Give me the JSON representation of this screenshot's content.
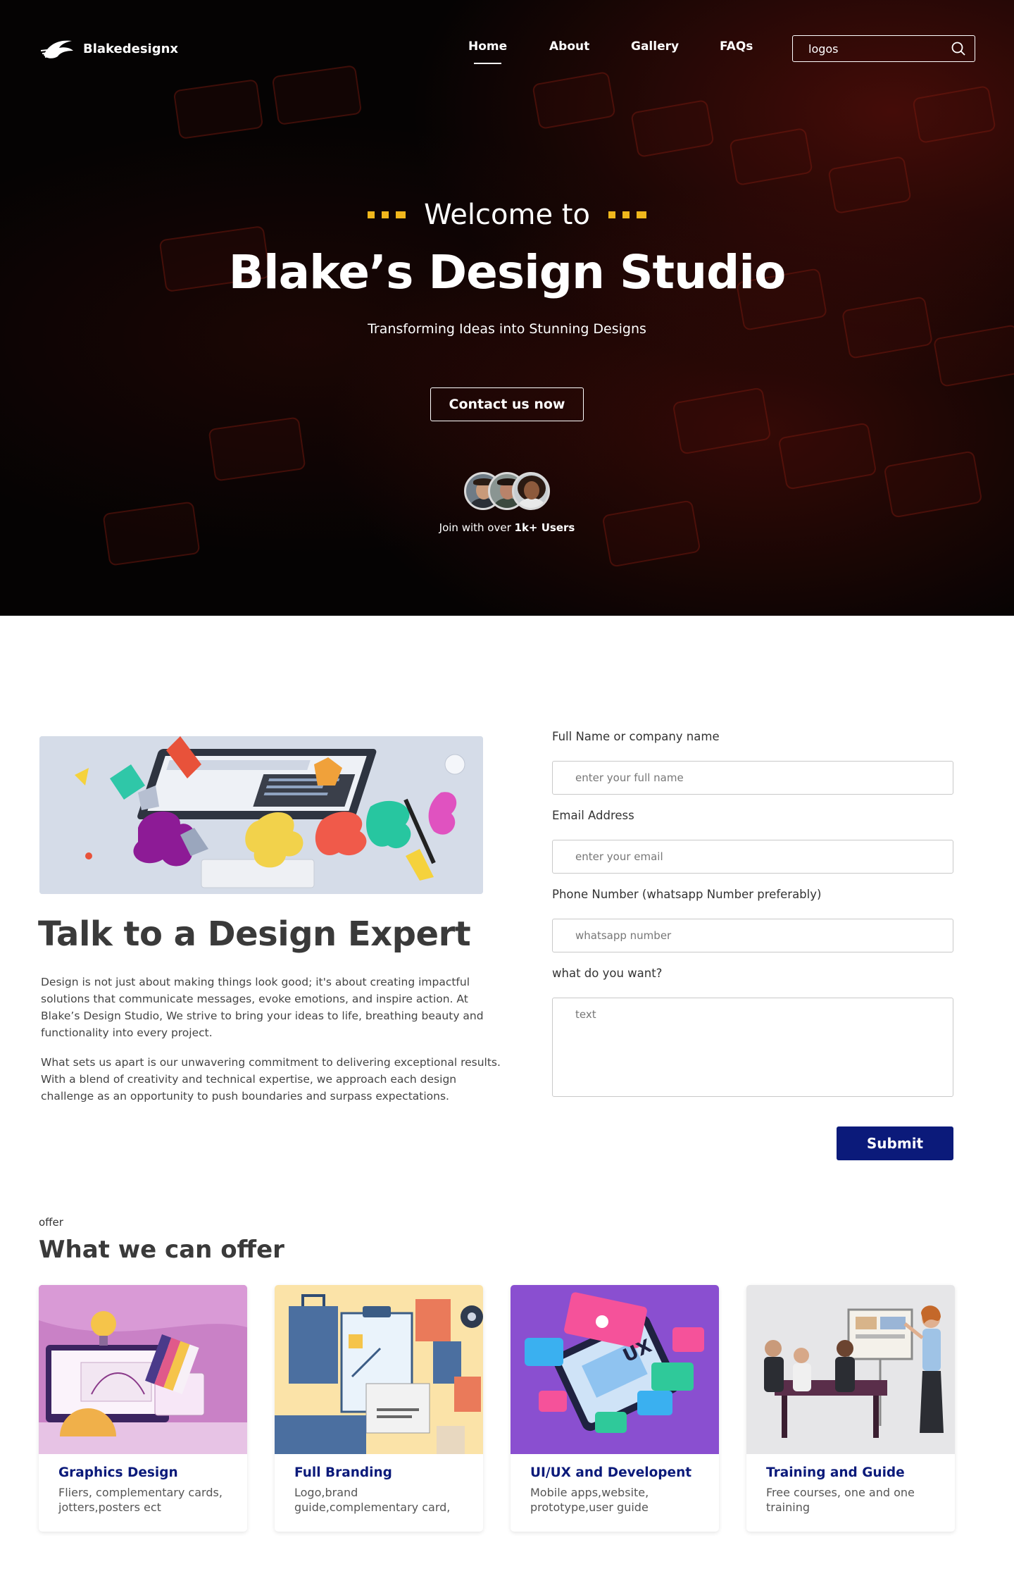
{
  "brand": {
    "name": "Blakedesignx"
  },
  "nav": {
    "items": [
      {
        "label": "Home"
      },
      {
        "label": "About"
      },
      {
        "label": "Gallery"
      },
      {
        "label": "FAQs"
      }
    ],
    "search": {
      "value": "logos",
      "placeholder": "logos"
    }
  },
  "hero": {
    "welcome": "Welcome to",
    "title": "Blake’s Design Studio",
    "subtitle": "Transforming Ideas into Stunning Designs",
    "cta": "Contact us now",
    "join_prefix": "Join with over ",
    "join_bold": "1k+ Users"
  },
  "expert": {
    "title": "Talk to a Design Expert",
    "p1": "Design is not just about making things look good; it's about creating impactful solutions that communicate messages, evoke emotions, and inspire action. At Blake’s Design Studio, We strive to bring your ideas to life, breathing beauty and functionality into every project.",
    "p2": "What sets us apart is our unwavering commitment to delivering exceptional results. With a blend of creativity and technical expertise, we approach each design challenge as an opportunity to push boundaries and surpass expectations."
  },
  "form": {
    "name_label": "Full Name or company name",
    "name_placeholder": "enter your full name",
    "email_label": "Email Address",
    "email_placeholder": "enter your email",
    "phone_label": "Phone Number (whatsapp Number preferably)",
    "phone_placeholder": "whatsapp number",
    "want_label": "what do you want?",
    "want_placeholder": "text",
    "submit": "Submit"
  },
  "offer": {
    "kicker": "offer",
    "title": "What we can offer",
    "cards": [
      {
        "title": "Graphics Design",
        "desc": "Fliers, complementary cards, jotters,posters ect"
      },
      {
        "title": "Full Branding",
        "desc": "Logo,brand guide,complementary card,"
      },
      {
        "title": "UI/UX and Developent",
        "desc": "Mobile apps,website, prototype,user guide"
      },
      {
        "title": "Training and Guide",
        "desc": "Free courses, one and one training"
      }
    ]
  },
  "colors": {
    "accent_yellow": "#f0b71c",
    "submit_navy": "#0b1a7a",
    "hero_bg": "#050303"
  }
}
